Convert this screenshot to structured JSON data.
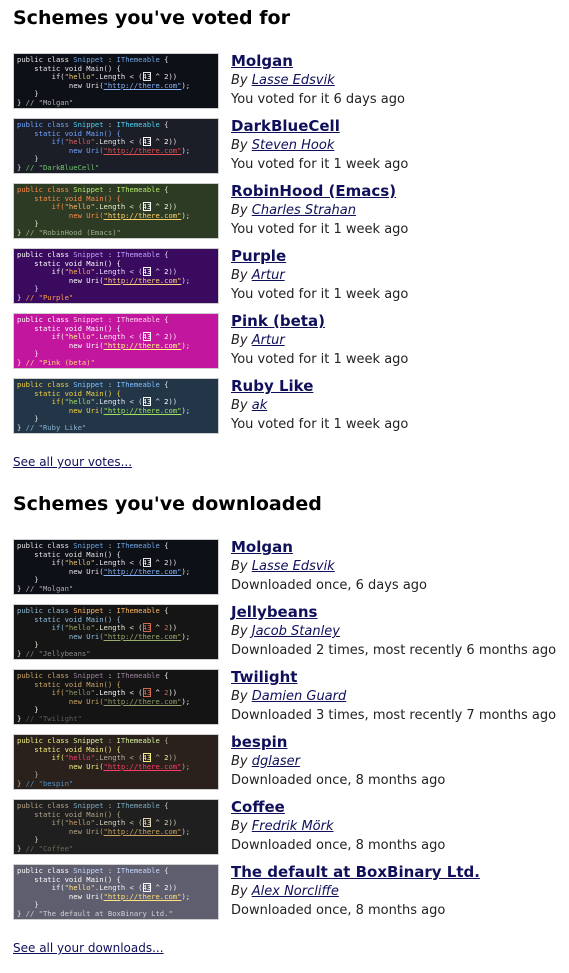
{
  "voted": {
    "title": "Schemes you've voted for",
    "see_all": "See all your votes...",
    "items": [
      {
        "name": "Molgan",
        "author": "Lasse Edsvik",
        "meta": "You voted for it 6 days ago",
        "theme": {
          "bg": "#0d1017",
          "kw": "#e6e6e6",
          "cls": "#6fa5e0",
          "text": "#e6e6e6",
          "str": "#f0c674",
          "num": "#e6e6e6",
          "url": "#8ab4f8",
          "cm": "#b0b0b0"
        },
        "label": "\"Molgan\""
      },
      {
        "name": "DarkBlueCell",
        "author": "Steven Hook",
        "meta": "You voted for it 1 week ago",
        "theme": {
          "bg": "#1c1e27",
          "kw": "#6fa5ff",
          "cls": "#4fd0f0",
          "text": "#e0e0e0",
          "str": "#e06060",
          "num": "#ffffff",
          "url": "#e05050",
          "cm": "#6ec26e"
        },
        "label": "\"DarkBlueCell\""
      },
      {
        "name": "RobinHood (Emacs)",
        "author": "Charles Strahan",
        "meta": "You voted for it 1 week ago",
        "theme": {
          "bg": "#2e3b24",
          "kw": "#ff8a4a",
          "cls": "#b5e86a",
          "text": "#e8e8c8",
          "str": "#ffb36a",
          "num": "#ffffff",
          "url": "#ffd36a",
          "cm": "#9ab08a"
        },
        "label": "\"RobinHood (Emacs)\""
      },
      {
        "name": "Purple",
        "author": "Artur",
        "meta": "You voted for it 1 week ago",
        "theme": {
          "bg": "#3a0a5e",
          "kw": "#ffffff",
          "cls": "#c0a0ff",
          "text": "#e8d8ff",
          "str": "#ffb060",
          "num": "#ffffff",
          "url": "#ffd080",
          "cm": "#ffa040"
        },
        "label": "\"Purple\""
      },
      {
        "name": "Pink (beta)",
        "author": "Artur",
        "meta": "You voted for it 1 week ago",
        "theme": {
          "bg": "#c2169e",
          "kw": "#ffffff",
          "cls": "#ffd0f0",
          "text": "#ffe8f8",
          "str": "#ffff80",
          "num": "#ffffff",
          "url": "#ffff80",
          "cm": "#ffd080"
        },
        "label": "\"Pink (beta)\""
      },
      {
        "name": "Ruby Like",
        "author": "ak",
        "meta": "You voted for it 1 week ago",
        "theme": {
          "bg": "#233648",
          "kw": "#f0d040",
          "cls": "#7ec0ff",
          "text": "#e0e8f0",
          "str": "#a0e060",
          "num": "#ffffff",
          "url": "#a0e060",
          "cm": "#8ab0d0"
        },
        "label": "\"Ruby Like\""
      }
    ]
  },
  "downloaded": {
    "title": "Schemes you've downloaded",
    "see_all": "See all your downloads...",
    "items": [
      {
        "name": "Molgan",
        "author": "Lasse Edsvik",
        "meta": "Downloaded once, 6 days ago",
        "theme": {
          "bg": "#0d1017",
          "kw": "#e6e6e6",
          "cls": "#6fa5e0",
          "text": "#e6e6e6",
          "str": "#f0c674",
          "num": "#e6e6e6",
          "url": "#8ab4f8",
          "cm": "#b0b0b0"
        },
        "label": "\"Molgan\""
      },
      {
        "name": "Jellybeans",
        "author": "Jacob Stanley",
        "meta": "Downloaded 2 times, most recently 6 months ago",
        "theme": {
          "bg": "#151515",
          "kw": "#8fbfdc",
          "cls": "#ffb964",
          "text": "#e8e8d3",
          "str": "#99ad6a",
          "num": "#cf6a4c",
          "url": "#99ad6a",
          "cm": "#888888"
        },
        "label": "\"Jellybeans\""
      },
      {
        "name": "Twilight",
        "author": "Damien Guard",
        "meta": "Downloaded 3 times, most recently 7 months ago",
        "theme": {
          "bg": "#141414",
          "kw": "#cda869",
          "cls": "#9b859d",
          "text": "#f8f8f8",
          "str": "#8f9d6a",
          "num": "#cf6a4c",
          "url": "#8f9d6a",
          "cm": "#5f5a60"
        },
        "label": "\"Twilight\""
      },
      {
        "name": "bespin",
        "author": "dglaser",
        "meta": "Downloaded once, 8 months ago",
        "theme": {
          "bg": "#2a211c",
          "kw": "#f6f080",
          "cls": "#ddf2a4",
          "text": "#baae9e",
          "str": "#ff3a6a",
          "num": "#f6f080",
          "url": "#ff3a6a",
          "cm": "#4d90c8"
        },
        "label": "\"bespin\""
      },
      {
        "name": "Coffee",
        "author": "Fredrik Mörk",
        "meta": "Downloaded once, 8 months ago",
        "theme": {
          "bg": "#1f1f1f",
          "kw": "#b5a58a",
          "cls": "#7fa8c0",
          "text": "#d8d0c0",
          "str": "#c8a060",
          "num": "#e0d0b0",
          "url": "#c8a060",
          "cm": "#6a6a5a"
        },
        "label": "\"Coffee\""
      },
      {
        "name": "The default at BoxBinary Ltd.",
        "author": "Alex Norcliffe",
        "meta": "Downloaded once, 8 months ago",
        "theme": {
          "bg": "#5e5e6e",
          "kw": "#ffffff",
          "cls": "#c8d8ff",
          "text": "#f0f0f0",
          "str": "#ffe080",
          "num": "#ffffff",
          "url": "#ffe080",
          "cm": "#d0d0d8"
        },
        "label": "\"The default at BoxBinary Ltd.\""
      }
    ]
  },
  "code": {
    "line1_a": "public class ",
    "line1_b": "Snippet",
    "line1_c": " : ",
    "line1_d": "IThemeable",
    "line1_e": " {",
    "line2": "    static void Main() {",
    "line3_a": "        if(",
    "line3_b": "\"hello\"",
    "line3_c": ".Length < (",
    "line3_d": "43",
    "line3_e": " ^ ",
    "line3_f": "2",
    "line3_g": "))",
    "line4_a": "            new Uri(",
    "line4_b": "\"http://there.com\"",
    "line4_c": ");",
    "line5": "    }",
    "line6_a": "} ",
    "line6_b": "// "
  }
}
